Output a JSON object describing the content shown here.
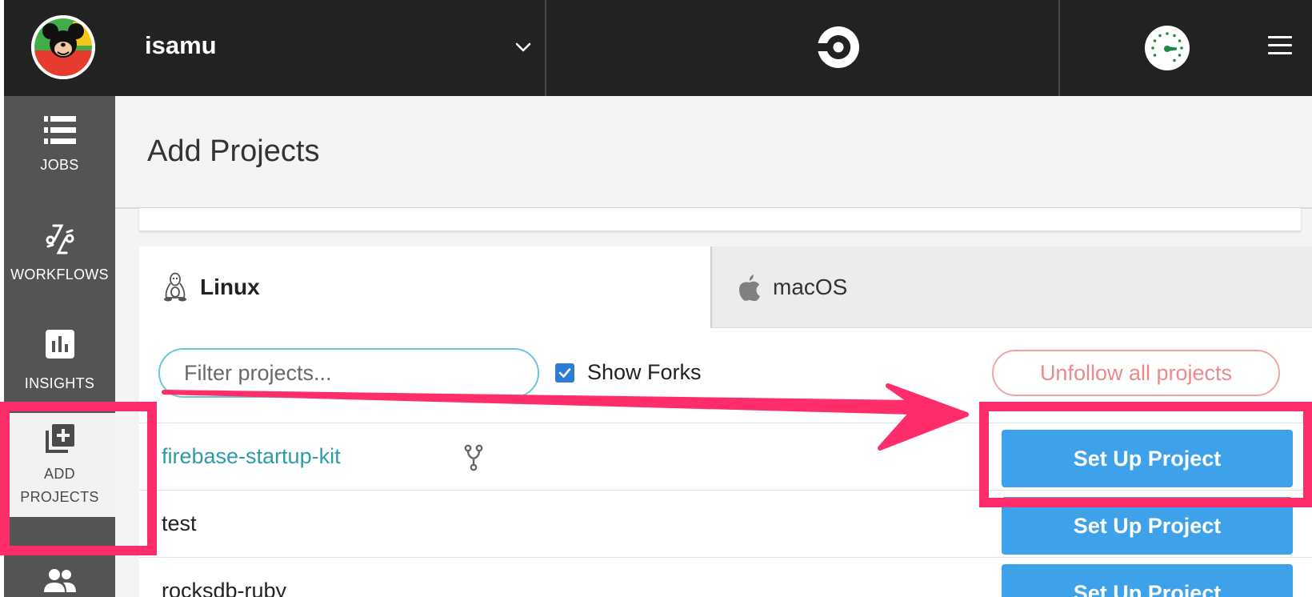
{
  "topbar": {
    "org_name": "isamu",
    "icons": [
      "avatar",
      "chevron-down-icon",
      "circleci-logo",
      "gauge-icon",
      "hamburger-menu-icon"
    ]
  },
  "sidebar": {
    "items": [
      {
        "label": "JOBS",
        "icon": "jobs-icon"
      },
      {
        "label": "WORKFLOWS",
        "icon": "workflows-icon"
      },
      {
        "label": "INSIGHTS",
        "icon": "insights-icon"
      },
      {
        "label": "ADD\nPROJECTS",
        "icon": "add-projects-icon",
        "active": true
      },
      {
        "label": "",
        "icon": "team-icon"
      }
    ]
  },
  "page": {
    "title": "Add Projects"
  },
  "tabs": [
    {
      "label": "Linux",
      "icon": "linux-icon",
      "selected": true
    },
    {
      "label": "macOS",
      "icon": "apple-icon",
      "selected": false
    }
  ],
  "filter": {
    "placeholder": "Filter projects...",
    "value": ""
  },
  "show_forks": {
    "label": "Show Forks",
    "checked": true
  },
  "unfollow_label": "Unfollow all projects",
  "projects": [
    {
      "name": "firebase-startup-kit",
      "is_fork": true,
      "button": "Set Up Project"
    },
    {
      "name": "test",
      "is_fork": false,
      "button": "Set Up Project"
    },
    {
      "name": "rocksdb-ruby",
      "is_fork": false,
      "button": "Set Up Project"
    }
  ],
  "colors": {
    "topbar": "#222222",
    "sidebar": "#545454",
    "primary_button": "#3ea2eb",
    "link": "#2e9aaa",
    "unfollow": "#ec8a8a",
    "annotation": "#ff2d6a"
  }
}
